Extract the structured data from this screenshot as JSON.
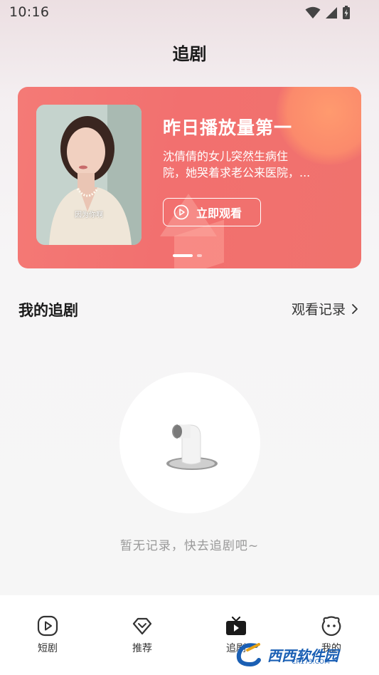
{
  "status_bar": {
    "time": "10:16",
    "icons": [
      "wifi-icon",
      "signal-icon",
      "battery-charging-icon"
    ]
  },
  "header": {
    "title": "追剧"
  },
  "banner": {
    "poster_caption": "因为你啊",
    "title": "昨日播放量第一",
    "description_line1": "沈倩倩的女儿突然生病住",
    "description_line2": "院，她哭着求老公来医院，...",
    "button_label": "立即观看",
    "active_slide": 1,
    "slide_count": 2,
    "colors": {
      "background": "#f2716f",
      "accent_glow": "#fb8a6c"
    }
  },
  "my_drama": {
    "title": "我的追剧",
    "history_label": "观看记录"
  },
  "empty_state": {
    "message": "暂无记录，快去追剧吧~"
  },
  "bottom_nav": {
    "items": [
      {
        "label": "短剧",
        "icon": "play-circle-icon"
      },
      {
        "label": "推荐",
        "icon": "diamond-icon"
      },
      {
        "label": "追剧",
        "icon": "tv-icon",
        "active": true
      },
      {
        "label": "我的",
        "icon": "face-icon"
      }
    ]
  },
  "watermark": {
    "text": "西西软件园",
    "url_text": "CR173.COM"
  }
}
